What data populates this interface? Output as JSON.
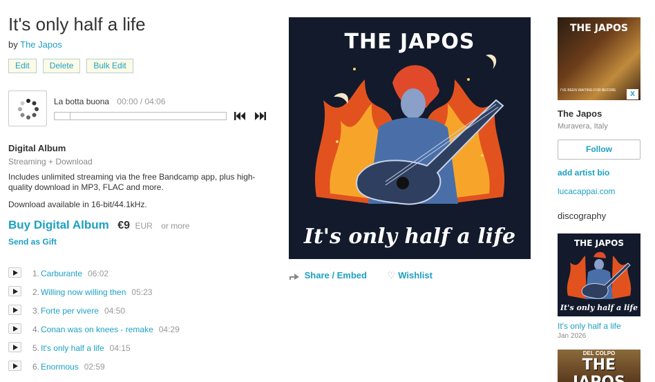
{
  "album": {
    "title": "It's only half a life",
    "by_prefix": "by",
    "artist": "The Japos"
  },
  "edit_buttons": [
    "Edit",
    "Delete",
    "Bulk Edit"
  ],
  "player": {
    "current_track": "La botta buona",
    "elapsed": "00:00",
    "separator": "/",
    "duration": "04:06",
    "progress_fraction": 0
  },
  "digital": {
    "title": "Digital Album",
    "subtitle": "Streaming + Download",
    "description": "Includes unlimited streaming via the free Bandcamp app, plus high-quality download in MP3, FLAC and more.",
    "availability": "Download available in 16-bit/44.1kHz.",
    "buy_label": "Buy Digital Album",
    "price": "€9",
    "currency": "EUR",
    "or_more": "or more",
    "gift_label": "Send as Gift"
  },
  "tracks": [
    {
      "num": "1.",
      "title": "Carburante",
      "duration": "06:02"
    },
    {
      "num": "2.",
      "title": "Willing now willing then",
      "duration": "05:23"
    },
    {
      "num": "3.",
      "title": "Forte per vivere",
      "duration": "04:50"
    },
    {
      "num": "4.",
      "title": "Conan was on knees - remake",
      "duration": "04:29"
    },
    {
      "num": "5.",
      "title": "It's only half a life",
      "duration": "04:15"
    },
    {
      "num": "6.",
      "title": "Enormous",
      "duration": "02:59"
    }
  ],
  "cover": {
    "top_text": "THE JAPOS",
    "bottom_text": "It's only half a life"
  },
  "share": {
    "share_label": "Share / Embed",
    "wishlist_label": "Wishlist"
  },
  "artist": {
    "photo_title": "THE JAPOS",
    "photo_footer": "I'VE BEEN WAITING FOR BEFORE",
    "close": "X",
    "name": "The Japos",
    "location": "Muravera, Italy",
    "follow_label": "Follow",
    "bio_link": "add artist bio",
    "website": "lucacappai.com"
  },
  "discography": {
    "title": "discography",
    "items": [
      {
        "name": "It's only half a life",
        "date": "Jan 2026",
        "art_top": "THE JAPOS",
        "art_bottom": "It's only half a life"
      },
      {
        "art_top": "DEL COLPO",
        "art_big": "THE JAPOS"
      }
    ]
  },
  "colors": {
    "link": "#1da0c3",
    "edit_button_bg": "#fdfbe6",
    "cover_bg": "#121a2c"
  }
}
